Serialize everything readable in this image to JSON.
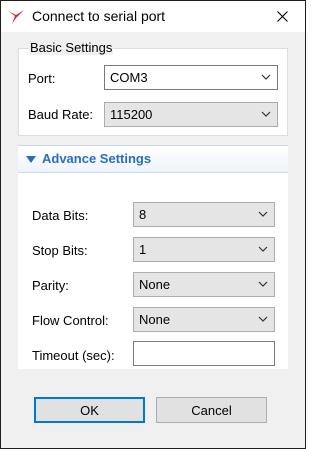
{
  "window": {
    "title": "Connect to serial port"
  },
  "basic": {
    "group_label": "Basic Settings",
    "port_label": "Port:",
    "port_value": "COM3",
    "baud_label": "Baud Rate:",
    "baud_value": "115200"
  },
  "advanced": {
    "title": "Advance Settings",
    "data_bits_label": "Data Bits:",
    "data_bits_value": "8",
    "stop_bits_label": "Stop Bits:",
    "stop_bits_value": "1",
    "parity_label": "Parity:",
    "parity_value": "None",
    "flow_label": "Flow Control:",
    "flow_value": "None",
    "timeout_label": "Timeout (sec):",
    "timeout_value": ""
  },
  "buttons": {
    "ok": "OK",
    "cancel": "Cancel"
  },
  "colors": {
    "accent": "#2a6ebb",
    "focus": "#0078d7"
  }
}
